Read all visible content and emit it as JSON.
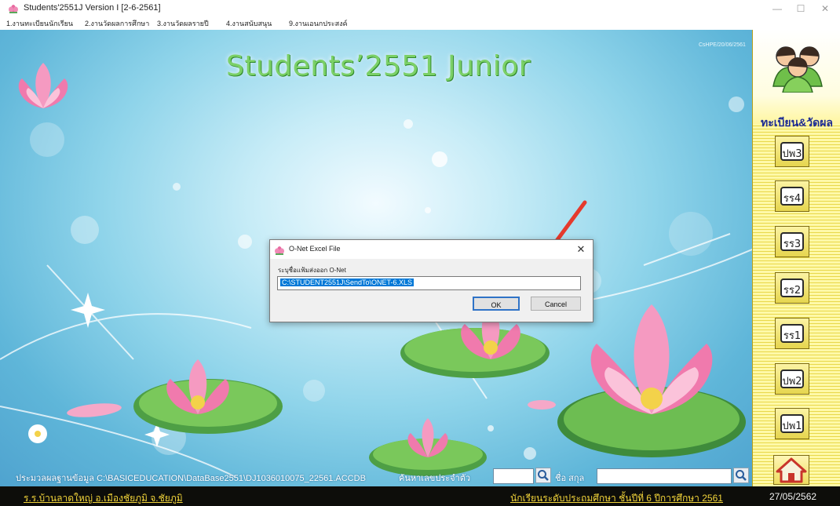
{
  "window": {
    "title": "Students'2551J Version I [2-6-2561]",
    "minimize": "—",
    "maximize": "☐",
    "close": "✕"
  },
  "menu": [
    {
      "label": "1.งานทะเบียนนักเรียน"
    },
    {
      "label": "2.งานวัดผลการศึกษา"
    },
    {
      "label": "3.งานวัดผลรายปี"
    },
    {
      "label": "4.งานสนับสนุน"
    },
    {
      "label": "9.งานเอนกประสงค์"
    }
  ],
  "app": {
    "title": "Students’2551 Junior",
    "version_tag": "CsHPE/20/06/2561"
  },
  "right_panel": {
    "label": "ทะเบียน&วัดผล",
    "buttons": [
      {
        "label": "ปพ3",
        "icon": "document-icon"
      },
      {
        "label": "รร4",
        "icon": "document-icon"
      },
      {
        "label": "รร3",
        "icon": "document-icon"
      },
      {
        "label": "รร2",
        "icon": "document-icon"
      },
      {
        "label": "รร1",
        "icon": "document-icon"
      },
      {
        "label": "ปพ2",
        "icon": "document-icon"
      },
      {
        "label": "ปพ1",
        "icon": "document-icon"
      }
    ],
    "home_icon": "home-icon",
    "users_icon": "users-icon"
  },
  "search_bar": {
    "db_path": "ประมวลผลฐานข้อมูล C:\\BASICEDUCATION\\DataBase2551\\DJ1036010075_22561.ACCDB",
    "id_label": "ค้นหาเลขประจำตัว",
    "id_value": "",
    "name_label": "ชื่อ  สกุล",
    "name_value": ""
  },
  "status_bar": {
    "school": "ร.ร.บ้านลาดใหญ่  อ.เมืองชัยภูมิ  จ.ชัยภูมิ",
    "level": "นักเรียนระดับประถมศึกษา  ชั้นปีที่ 6  ปีการศึกษา 2561",
    "date": "27/05/2562"
  },
  "dialog": {
    "title": "O-Net Excel File",
    "close": "✕",
    "prompt": "ระบุชื่อแฟ้มส่งออก O-Net",
    "path_value": "C:\\STUDENT2551J\\SendTo\\ONET-6.XLS",
    "ok_label": "OK",
    "cancel_label": "Cancel"
  },
  "colors": {
    "title_green": "#7bd067",
    "status_yellow": "#f3d53a",
    "panel_label_blue": "#1c2b93",
    "annotation_arrow": "#e53a2d"
  }
}
